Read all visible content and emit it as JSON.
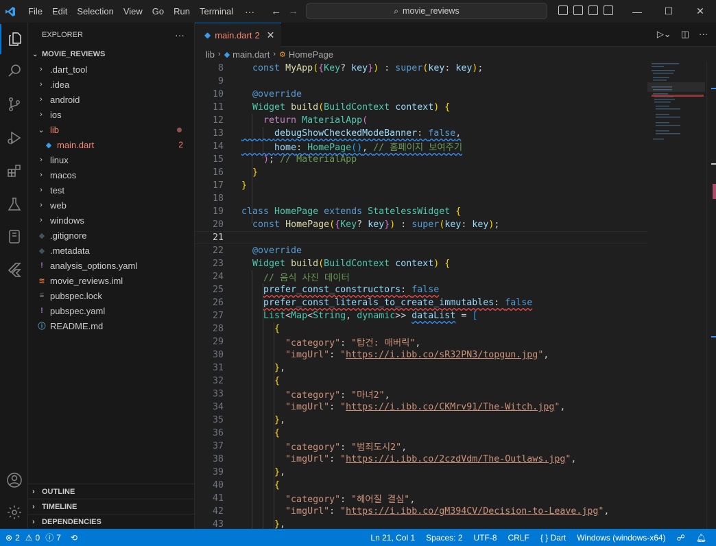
{
  "menu": [
    "File",
    "Edit",
    "Selection",
    "View",
    "Go",
    "Run",
    "Terminal"
  ],
  "search": {
    "text": "movie_reviews"
  },
  "explorer": {
    "title": "EXPLORER",
    "project": "MOVIE_REVIEWS",
    "items": [
      {
        "label": ".dart_tool",
        "type": "folder"
      },
      {
        "label": ".idea",
        "type": "folder"
      },
      {
        "label": "android",
        "type": "folder"
      },
      {
        "label": "ios",
        "type": "folder"
      },
      {
        "label": "lib",
        "type": "folder-open"
      },
      {
        "label": "main.dart",
        "type": "file",
        "badge": "2"
      },
      {
        "label": "linux",
        "type": "folder"
      },
      {
        "label": "macos",
        "type": "folder"
      },
      {
        "label": "test",
        "type": "folder"
      },
      {
        "label": "web",
        "type": "folder"
      },
      {
        "label": "windows",
        "type": "folder"
      },
      {
        "label": ".gitignore",
        "type": "file"
      },
      {
        "label": ".metadata",
        "type": "file"
      },
      {
        "label": "analysis_options.yaml",
        "type": "file"
      },
      {
        "label": "movie_reviews.iml",
        "type": "file"
      },
      {
        "label": "pubspec.lock",
        "type": "file"
      },
      {
        "label": "pubspec.yaml",
        "type": "file"
      },
      {
        "label": "README.md",
        "type": "file"
      }
    ],
    "sections": [
      "OUTLINE",
      "TIMELINE",
      "DEPENDENCIES"
    ]
  },
  "tab": {
    "label": "main.dart",
    "errors": "2"
  },
  "breadcrumb": {
    "folder": "lib",
    "file": "main.dart",
    "symbol": "HomePage"
  },
  "line_numbers": [
    "8",
    "9",
    "10",
    "11",
    "12",
    "13",
    "14",
    "15",
    "16",
    "17",
    "18",
    "19",
    "20",
    "21",
    "22",
    "23",
    "24",
    "25",
    "26",
    "27",
    "28",
    "29",
    "30",
    "31",
    "32",
    "33",
    "34",
    "35",
    "36",
    "37",
    "38",
    "39",
    "40",
    "41",
    "42",
    "43"
  ],
  "code": {
    "l13_comment": "// 홈페이지 보여주기",
    "l15_comment": "// MaterialApp",
    "l24_comment": "// 음식 사진 데이터",
    "items": [
      {
        "category": "\"탑건: 매버릭\"",
        "url": "https://i.ibb.co/sR32PN3/topgun.jpg"
      },
      {
        "category": "\"마녀2\"",
        "url": "https://i.ibb.co/CKMrv91/The-Witch.jpg"
      },
      {
        "category": "\"범죄도시2\"",
        "url": "https://i.ibb.co/2czdVdm/The-Outlaws.jpg"
      },
      {
        "category": "\"헤어질 결심\"",
        "url": "https://i.ibb.co/gM394CV/Decision-to-Leave.jpg"
      }
    ]
  },
  "status": {
    "errors": "2",
    "warnings": "0",
    "info": "7",
    "position": "Ln 21, Col 1",
    "spaces": "Spaces: 2",
    "encoding": "UTF-8",
    "eol": "CRLF",
    "language": "Dart",
    "device": "Windows (windows-x64)"
  }
}
